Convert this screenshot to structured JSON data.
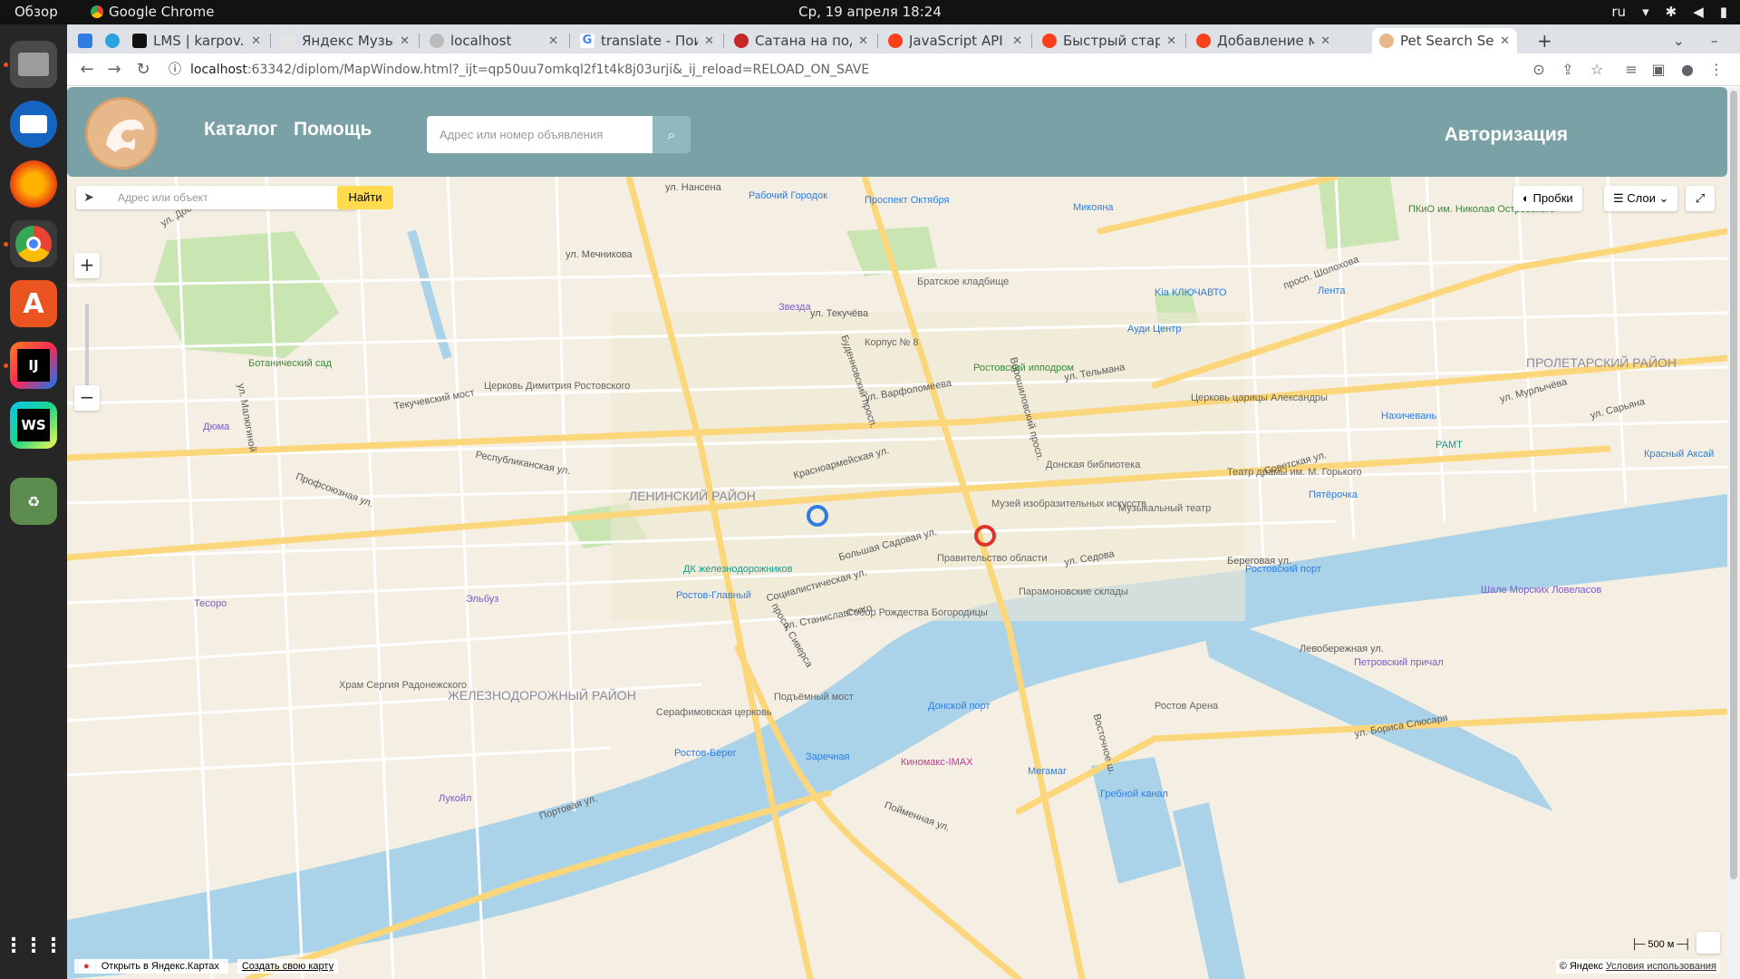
{
  "topbar": {
    "overview": "Обзор",
    "app_name": "Google Chrome",
    "clock": "Ср, 19 апреля 18:24",
    "lang": "ru"
  },
  "dock": {
    "items": [
      "files",
      "thunderbird",
      "firefox",
      "chrome",
      "app-center",
      "intellij-idea",
      "webstorm",
      "trash",
      "app-grid"
    ]
  },
  "tabs": [
    {
      "label": "",
      "icon": "messenger-icon"
    },
    {
      "label": "",
      "icon": "telegram-icon"
    },
    {
      "label": "LMS | karpov.co",
      "icon": "karpov-icon"
    },
    {
      "label": "Яндекс Музыка",
      "icon": "pause-icon"
    },
    {
      "label": "localhost",
      "icon": "globe-icon"
    },
    {
      "label": "translate - Пои",
      "icon": "google-icon"
    },
    {
      "label": "Сатана на под",
      "icon": "yandex-icon"
    },
    {
      "label": "JavaScript API",
      "icon": "yandex-icon"
    },
    {
      "label": "Быстрый старт",
      "icon": "yandex-icon"
    },
    {
      "label": "Добавление м",
      "icon": "yandex-icon"
    },
    {
      "label": "Pet Search Serv",
      "icon": "pet-icon"
    }
  ],
  "address": {
    "host": "localhost",
    "rest": ":63342/diplom/MapWindow.html?_ijt=qp50uu7omkql2f1t4k8j03urji&_ij_reload=RELOAD_ON_SAVE"
  },
  "site": {
    "nav": {
      "catalog": "Каталог",
      "help": "Помощь",
      "auth": "Авторизация"
    },
    "search_placeholder": "Адрес или номер объявления",
    "colors": {
      "header": "#7aa1a6",
      "search_button": "#91b8bd",
      "logo": "#e7b98a"
    }
  },
  "map": {
    "search_placeholder": "Адрес или объект",
    "find_button": "Найти",
    "traffic_button": "Пробки",
    "layers_button": "Слои",
    "scale": "500 м",
    "open_in_yandex": "Открыть в Яндекс.Картах",
    "create_map": "Создать свою карту",
    "copyright": "© Яндекс",
    "terms": "Условия использования",
    "districts": [
      {
        "name": "Ленинский район"
      },
      {
        "name": "Железнодорожный район"
      },
      {
        "name": "Пролетарский район"
      }
    ],
    "pois": [
      "Ботанический сад",
      "Церковь Димитрия Ростовского",
      "Дюма",
      "Звезда",
      "Братское кладбище",
      "Рабочий Городок",
      "Проспект Октября",
      "Корпус № 8",
      "Ростовский ипподром",
      "Микояна",
      "Kia КЛЮЧАВТО",
      "Ауди Центр",
      "Лента",
      "ПКиО им. Николая Островского",
      "Церковь царицы Александры",
      "Донская библиотека",
      "Музей изобразительных искусств",
      "Музыкальный театр",
      "Театр драмы им. М. Горького",
      "Пятёрочка",
      "Правительство области",
      "ДК железнодорожников",
      "Ростов-Главный",
      "Собор Рождества Богородицы",
      "Парамоновские склады",
      "Ростовский порт",
      "Шале Морских Ловеласов",
      "Петровский причал",
      "Донской порт",
      "Ростов Арена",
      "Подъёмный мост",
      "Серафимовская церковь",
      "Храм Сергия Радонежского",
      "Ростов-Берег",
      "Заречная",
      "Киномакс-IMAX",
      "Мегамаг",
      "Гребной канал",
      "Тесоро",
      "Эльбуз",
      "Лукойл",
      "РАМТ",
      "Нахичевань",
      "Красный Аксай"
    ],
    "streets": [
      "ул. Доватора",
      "ул. Нансена",
      "ул. Мечникова",
      "ул. Текучёва",
      "Красноармейская ул.",
      "Большая Садовая ул.",
      "Социалистическая ул.",
      "ул. Станиславского",
      "Береговая ул.",
      "Ворошиловский просп.",
      "Буденновский просп.",
      "просп. Сиверса",
      "просп. Шолохова",
      "Советская ул.",
      "Левобережная ул.",
      "ул. Бориса Слюсаря",
      "Поймeнная ул.",
      "Восточное ш.",
      "Портовая ул.",
      "Профсоюзная ул.",
      "Республиканская ул.",
      "ул. Малюгиной",
      "Текучевский мост",
      "ул. Варфоломеева",
      "ул. Тельмана",
      "ул. Сарьяна",
      "ул. Мурлычёва",
      "ул. Седова"
    ],
    "markers": [
      {
        "name": "pet-marker-blue",
        "color": "#2f7de1"
      },
      {
        "name": "pet-marker-red",
        "color": "#e0332f"
      }
    ],
    "colors": {
      "water": "#aad3ea",
      "land": "#f4efe2",
      "park": "#c9e6b2",
      "road": "#fcd67a"
    }
  }
}
